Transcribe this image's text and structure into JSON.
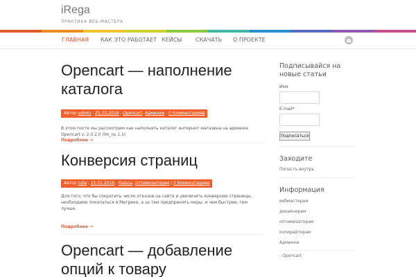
{
  "site": {
    "title": "iRega",
    "description": "ПРАКТИКА ВЕБ-МАСТЕРА"
  },
  "stripe_colors": [
    "#e25b2a",
    "#ef8f22",
    "#f2c12e",
    "#cfd22d",
    "#8fc43f",
    "#3fb6a7",
    "#2f8fcf",
    "#5b6bbf",
    "#8d58b6",
    "#c94e8f"
  ],
  "nav": {
    "items": [
      {
        "label": "ГЛАВНАЯ"
      },
      {
        "label": "КАК ЭТО РАБОТАЕТ"
      },
      {
        "label": "КЕЙСЫ"
      },
      {
        "label": "СКАЧАТЬ"
      },
      {
        "label": "О ПРОЕКТЕ"
      }
    ],
    "mail_icon": "envelope-icon"
  },
  "posts": [
    {
      "title": "Opencart — наполнение каталога",
      "meta": {
        "author_prefix": "Автор",
        "author": "admin",
        "date": "25.03.2016",
        "categories": [
          "Opencart",
          "Админки"
        ],
        "comments": "0 Комментариев"
      },
      "excerpt": "В этом посте мы рассмотрим как наполнять каталог интернет-магазина на админке Opencart v. 2.0.2.0 (lm_ns 1.1)",
      "more": "Подробнее →"
    },
    {
      "title": "Конверсия страниц",
      "meta": {
        "author_prefix": "Автор",
        "author": "julia",
        "date": "15.01.2016",
        "categories": [
          "Кейсы",
          "оптимизаторам"
        ],
        "comments": "2 Комментариев"
      },
      "excerpt": "Для того, что бы сократить число отказов на сайте и увеличить конверсию страницы, необходимо покопаться в Метрике, а за тем предпринять меры, и чем быстрее, тем лучше.",
      "more": "Подробнее →"
    },
    {
      "title": "Opencart — добавление опций к товару"
    }
  ],
  "sidebar": {
    "subscribe": {
      "title": "Подписывайся на новые статьи",
      "name_label": "Имя",
      "email_label": "E-mail*",
      "button": "Подписаться"
    },
    "login": {
      "title": "Заходите",
      "link": "Попасть внутрь"
    },
    "info": {
      "title": "Информация",
      "links": [
        "вебмастерам",
        "дизайнерам",
        "оптимизаторам",
        "копирайтерам",
        "Админки"
      ],
      "bottom_link": "- Opencart"
    }
  }
}
